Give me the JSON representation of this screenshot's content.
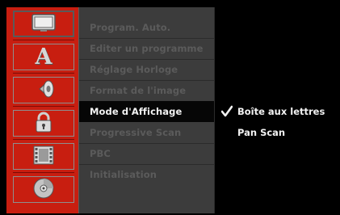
{
  "icons": [
    {
      "name": "display-icon"
    },
    {
      "name": "language-icon",
      "glyph": "A"
    },
    {
      "name": "audio-icon"
    },
    {
      "name": "lock-icon"
    },
    {
      "name": "film-icon"
    },
    {
      "name": "disc-icon"
    }
  ],
  "menu": {
    "items": [
      {
        "label": "Program. Auto."
      },
      {
        "label": "Editer un programme"
      },
      {
        "label": "Réglage Horloge"
      },
      {
        "label": "Format de l'image"
      },
      {
        "label": "Mode d'Affichage"
      },
      {
        "label": "Progressive Scan"
      },
      {
        "label": "PBC"
      },
      {
        "label": "Initialisation"
      }
    ],
    "selected_index": 4
  },
  "options": {
    "items": [
      {
        "label": "Boîte aux lettres",
        "checked": true
      },
      {
        "label": "Pan Scan",
        "checked": false
      }
    ]
  },
  "colors": {
    "icon_column": "#c81e10",
    "menu_background": "#3c3c3c",
    "active_item_background": "#060606",
    "active_text": "#f2f2f2",
    "dim_text": "#5b5b5b"
  }
}
